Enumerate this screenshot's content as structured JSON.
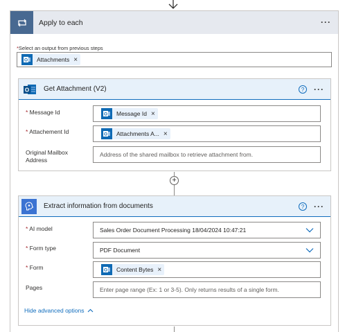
{
  "apply_each": {
    "title": "Apply to each",
    "select_label": "Select an output from previous steps",
    "token": "Attachments"
  },
  "get_attachment": {
    "title": "Get Attachment (V2)",
    "fields": {
      "message_id": {
        "label": "Message Id",
        "token": "Message Id"
      },
      "attachment_id": {
        "label": "Attachement Id",
        "token": "Attachments A..."
      },
      "mailbox": {
        "label_line1": "Original Mailbox",
        "label_line2": "Address",
        "placeholder": "Address of the shared mailbox to retrieve attachment from."
      }
    }
  },
  "extract": {
    "title": "Extract information from documents",
    "fields": {
      "ai_model": {
        "label": "AI model",
        "value": "Sales Order Document Processing 18/04/2024 10:47:21"
      },
      "form_type": {
        "label": "Form type",
        "value": "PDF Document"
      },
      "form": {
        "label": "Form",
        "token": "Content Bytes"
      },
      "pages": {
        "label": "Pages",
        "placeholder": "Enter page range (Ex: 1 or 3-5). Only returns results of a single form."
      }
    },
    "advanced_link": "Hide advanced options"
  },
  "icons": {
    "header_loop": "loop-icon",
    "outlook": "outlook-icon",
    "ai_builder": "ai-builder-icon",
    "help": "help-icon",
    "more": "more-options-icon",
    "remove": "close-icon",
    "chevron": "chevron-down-icon",
    "add": "plus-icon"
  },
  "colors": {
    "loop_header": "#486991",
    "container_header_bg": "#e6e9ef",
    "card_header_bg": "#e7f1fa",
    "accent_blue": "#0f6cbd",
    "outlook_blue": "#0f6ab4",
    "ai_accent": "#3b73d2",
    "required_red": "#a4262c"
  }
}
